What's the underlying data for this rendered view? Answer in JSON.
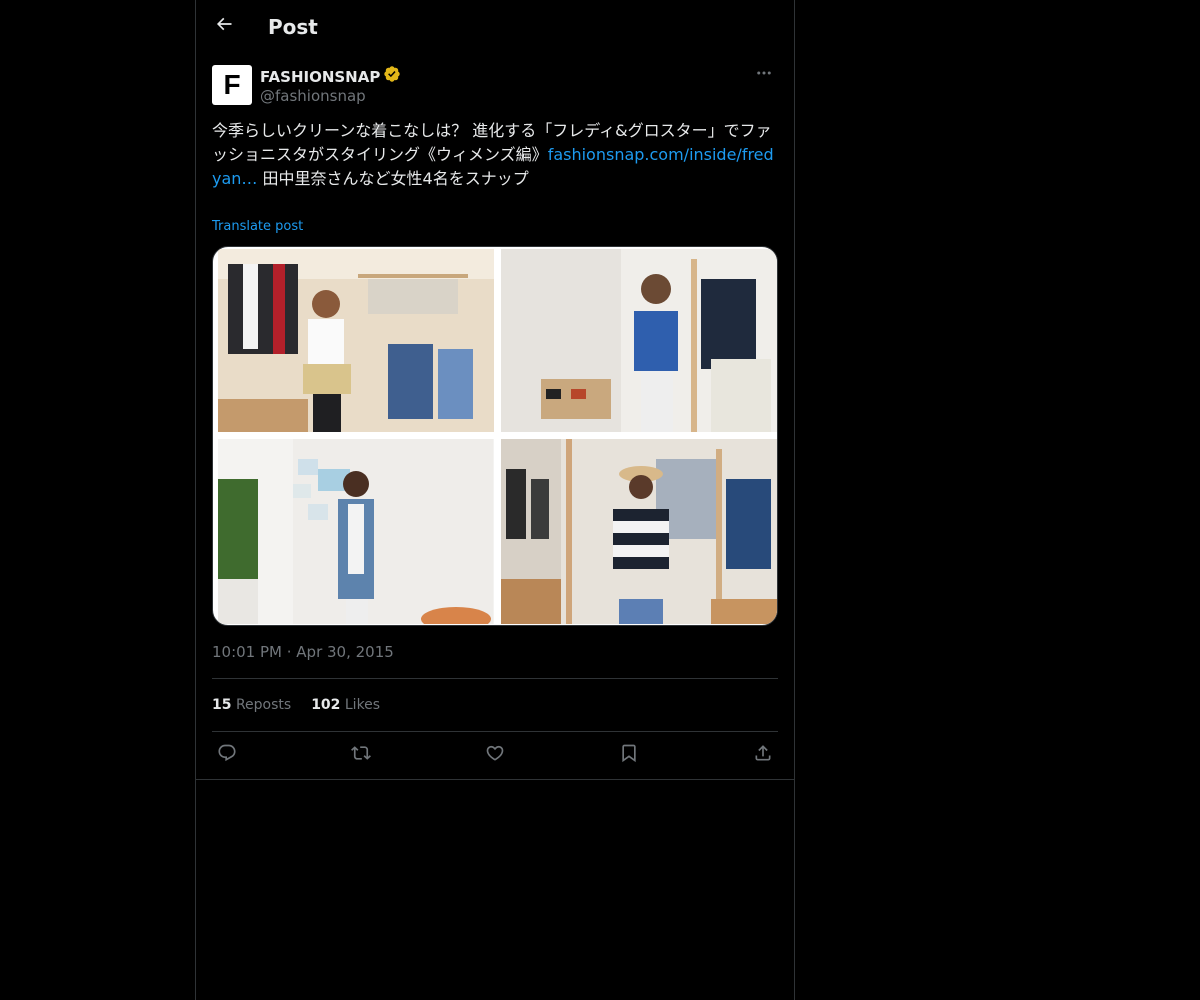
{
  "header": {
    "title": "Post",
    "back_icon": "arrow-left-icon"
  },
  "author": {
    "avatar_letter": "F",
    "display_name": "FASHIONSNAP",
    "handle": "@fashionsnap",
    "verified_color": "#e2b719"
  },
  "post": {
    "text_before_link": "今季らしいクリーンな着こなしは？ 進化する「フレディ&グロスター」でファッショニスタがスタイリング《ウィメンズ編》",
    "link_text": "fashionsnap.com/inside/fredyan…",
    "text_after_link": " 田中里奈さんなど女性4名をスナップ",
    "translate_label": "Translate post",
    "timestamp": "10:01 PM · Apr 30, 2015"
  },
  "stats": {
    "reposts_count": "15",
    "reposts_label": "Reposts",
    "likes_count": "102",
    "likes_label": "Likes"
  },
  "actions": [
    "reply-icon",
    "repost-icon",
    "like-icon",
    "bookmark-icon",
    "share-icon"
  ],
  "colors": {
    "background": "#000000",
    "text": "#e7e9ea",
    "muted": "#71767b",
    "link": "#1d9bf0",
    "border": "#2f3336"
  }
}
